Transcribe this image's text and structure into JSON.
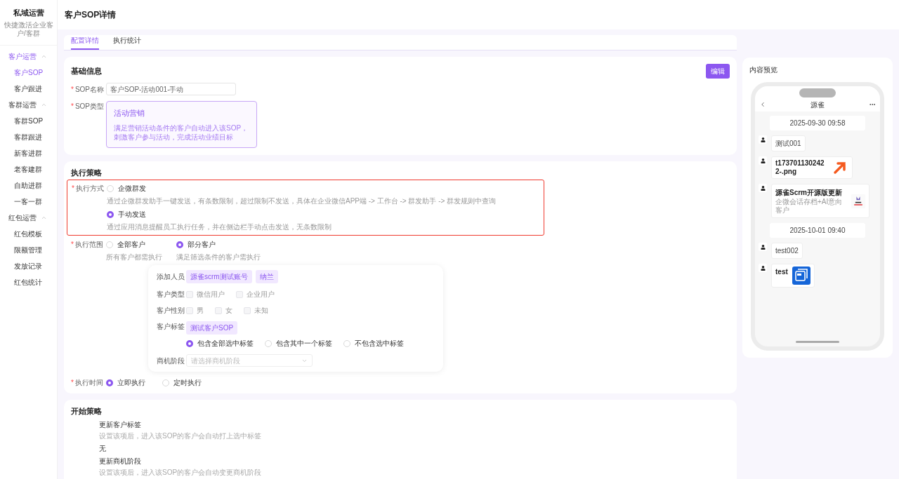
{
  "sidebar": {
    "title": "私域运营",
    "subtitle": "快捷激活企业客户/客群",
    "groups": [
      {
        "label": "客户运营",
        "expanded": true,
        "selected": true,
        "items": [
          {
            "label": "客户SOP",
            "selected": true
          },
          {
            "label": "客户跟进",
            "selected": false
          }
        ]
      },
      {
        "label": "客群运营",
        "expanded": true,
        "selected": false,
        "items": [
          {
            "label": "客群SOP",
            "selected": false
          },
          {
            "label": "客群跟进",
            "selected": false
          },
          {
            "label": "新客进群",
            "selected": false
          },
          {
            "label": "老客建群",
            "selected": false
          },
          {
            "label": "自助进群",
            "selected": false
          },
          {
            "label": "一客一群",
            "selected": false
          }
        ]
      },
      {
        "label": "红包运营",
        "expanded": true,
        "selected": false,
        "items": [
          {
            "label": "红包模板",
            "selected": false
          },
          {
            "label": "限额管理",
            "selected": false
          },
          {
            "label": "发放记录",
            "selected": false
          },
          {
            "label": "红包统计",
            "selected": false
          }
        ]
      }
    ]
  },
  "header": {
    "title": "客户SOP详情"
  },
  "tabs": [
    {
      "label": "配置详情",
      "selected": true
    },
    {
      "label": "执行统计",
      "selected": false
    }
  ],
  "basic_info": {
    "title": "基础信息",
    "edit_button": "编辑",
    "name_field": {
      "label": "SOP名称",
      "required_mark": "*",
      "value": "客户SOP-活动001-手动"
    },
    "type_field": {
      "label": "SOP类型",
      "required_mark": "*",
      "card_title": "活动营销",
      "card_lines": [
        "满足营销活动条件的客户自动进入该SOP，",
        "刺激客户参与活动，完成活动业绩目标"
      ]
    }
  },
  "execution": {
    "title": "执行策略",
    "method": {
      "label": "执行方式",
      "required_mark": "*",
      "options": [
        {
          "label": "企微群发",
          "description": "通过企微群发助手一键发送，有条数限制，超过限制不发送，具体在企业微信APP端 -> 工作台 -> 群发助手 -> 群发规则中查询",
          "selected": false
        },
        {
          "label": "手动发送",
          "description": "通过应用消息提醒员工执行任务，并在侧边栏手动点击发送，无条数限制",
          "selected": true
        }
      ]
    },
    "scope": {
      "label": "执行范围",
      "required_mark": "*",
      "options": [
        {
          "label": "全部客户",
          "description": "所有客户都需执行",
          "selected": false
        },
        {
          "label": "部分客户",
          "description": "满足筛选条件的客户需执行",
          "selected": true
        }
      ]
    },
    "filter": {
      "staff": {
        "label": "添加人员",
        "tags": [
          "源雀scrm测试账号",
          "纳兰"
        ]
      },
      "customer_type": {
        "label": "客户类型",
        "options": [
          {
            "label": "微信用户",
            "checked": false
          },
          {
            "label": "企业用户",
            "checked": false
          }
        ]
      },
      "gender": {
        "label": "客户性别",
        "options": [
          {
            "label": "男",
            "checked": false
          },
          {
            "label": "女",
            "checked": false
          },
          {
            "label": "未知",
            "checked": false
          }
        ]
      },
      "customer_tags": {
        "label": "客户标签",
        "tags": [
          "测试客户SOP"
        ],
        "match_options": [
          {
            "label": "包含全部选中标签",
            "selected": true
          },
          {
            "label": "包含其中一个标签",
            "selected": false
          },
          {
            "label": "不包含选中标签",
            "selected": false
          }
        ]
      },
      "stage": {
        "label": "商机阶段",
        "placeholder": "请选择商机阶段"
      }
    },
    "time": {
      "label": "执行时间",
      "required_mark": "*",
      "options": [
        {
          "label": "立即执行",
          "selected": true
        },
        {
          "label": "定时执行",
          "selected": false
        }
      ]
    }
  },
  "start_strategy": {
    "title": "开始策略",
    "sections": [
      {
        "title": "更新客户标签",
        "description": "设置该项后，进入该SOP的客户会自动打上选中标签",
        "value": "无"
      },
      {
        "title": "更新商机阶段",
        "description": "设置该项后，进入该SOP的客户会自动变更商机阶段"
      }
    ]
  },
  "preview": {
    "title": "内容预览",
    "chat_title": "源雀",
    "messages": [
      {
        "kind": "time",
        "text": "2025-09-30 09:58"
      },
      {
        "kind": "text",
        "text": "测试001"
      },
      {
        "text": "t1737011302422-.png"
      },
      {
        "kind": "link",
        "text": "源雀Scrm开源版更新",
        "description": "企微会话存档+AI意向客户"
      },
      {
        "kind": "time",
        "text": "2025-10-01 09:40"
      },
      {
        "kind": "text",
        "text": "test002"
      },
      {
        "kind": "file",
        "text": "test"
      }
    ]
  }
}
